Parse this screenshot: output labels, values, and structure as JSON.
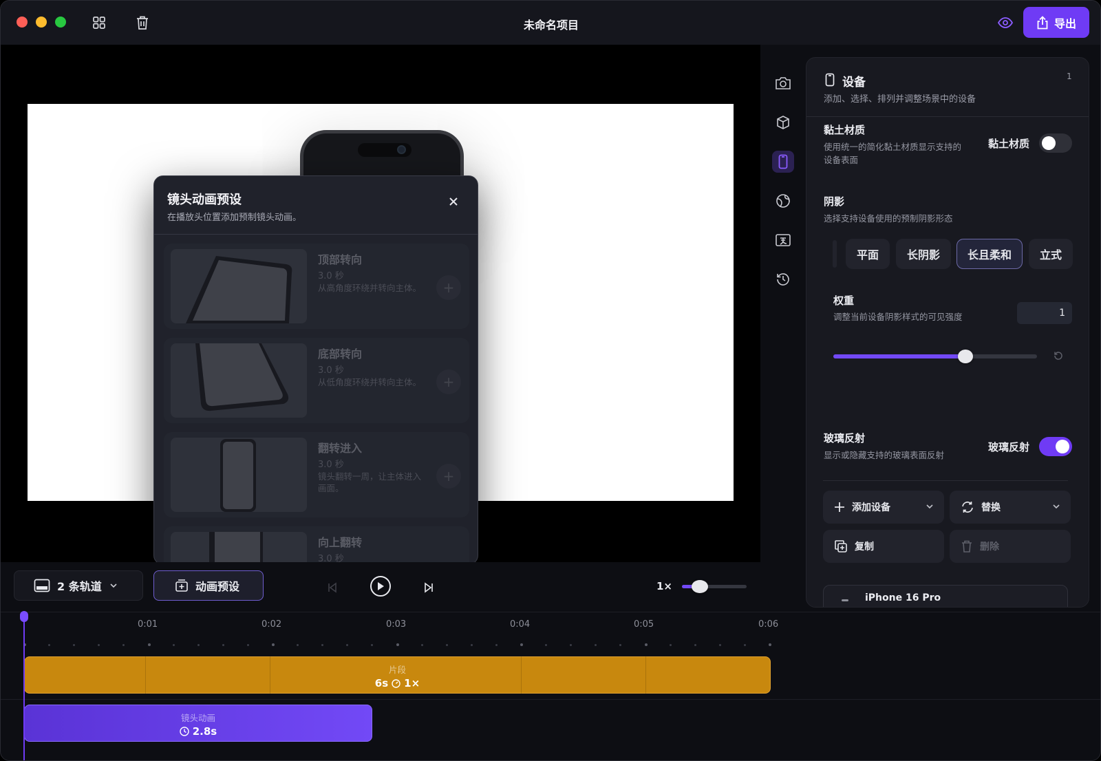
{
  "app": {
    "title": "未命名项目",
    "export_label": "导出"
  },
  "modal": {
    "title": "镜头动画预设",
    "subtitle": "在播放头位置添加预制镜头动画。",
    "presets": [
      {
        "name": "顶部转向",
        "duration": "3.0 秒",
        "description": "从高角度环绕并转向主体。"
      },
      {
        "name": "底部转向",
        "duration": "3.0 秒",
        "description": "从低角度环绕并转向主体。"
      },
      {
        "name": "翻转进入",
        "duration": "3.0 秒",
        "description": "镜头翻转一周，让主体进入画面。"
      },
      {
        "name": "向上翻转",
        "duration": "3.0 秒",
        "description": ""
      }
    ]
  },
  "panel": {
    "title": "设备",
    "subtitle": "添加、选择、排列并调整场景中的设备",
    "count": "1",
    "clay": {
      "title": "黏土材质",
      "subtitle": "使用统一的简化黏土材质显示支持的设备表面",
      "toggle_label": "黏土材质",
      "enabled": false
    },
    "shadow": {
      "title": "阴影",
      "subtitle": "选择支持设备使用的预制阴影形态",
      "options": [
        "平面",
        "长阴影",
        "长且柔和",
        "立式"
      ],
      "selected": "长且柔和"
    },
    "weight": {
      "title": "权重",
      "subtitle": "调整当前设备阴影样式的可见强度",
      "value": "1",
      "slider_fraction": 0.65
    },
    "glass": {
      "title": "玻璃反射",
      "subtitle": "显示或隐藏支持的玻璃表面反射",
      "toggle_label": "玻璃反射",
      "enabled": true
    },
    "actions": {
      "add_device": "添加设备",
      "replace": "替换",
      "duplicate": "复制",
      "delete": "删除"
    },
    "device_name": "iPhone 16 Pro"
  },
  "controls": {
    "tracks_label": "2 条轨道",
    "presets_label": "动画预设",
    "speed_label": "1×",
    "speed_fraction": 0.28
  },
  "timeline": {
    "ticks": [
      "0:01",
      "0:02",
      "0:03",
      "0:04",
      "0:05",
      "0:06"
    ],
    "segment_clip": {
      "title": "片段",
      "duration": "6s",
      "speed": "1×"
    },
    "camera_clip": {
      "title": "镜头动画",
      "duration": "2.8s"
    }
  },
  "colors": {
    "accent": "#6f3bf5",
    "segment_clip": "#c8880e",
    "camera_clip": "#6a3de8"
  }
}
